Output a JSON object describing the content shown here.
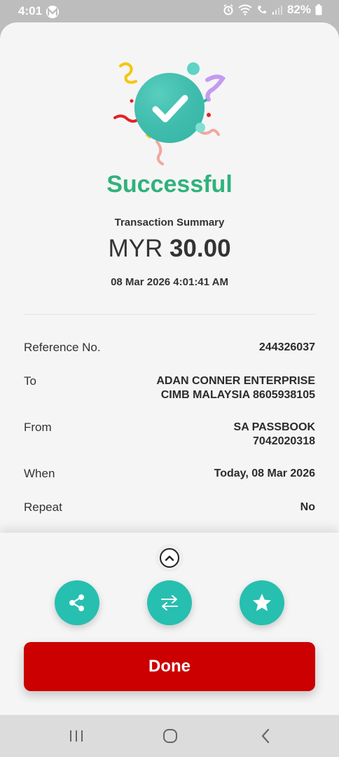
{
  "status_bar": {
    "time": "4:01",
    "battery": "82%"
  },
  "header": {
    "title": "Successful",
    "summary_label": "Transaction Summary",
    "currency": "MYR",
    "amount": "30.00",
    "datetime": "08 Mar 2026 4:01:41 AM"
  },
  "details": [
    {
      "label": "Reference No.",
      "value_lines": [
        "244326037"
      ]
    },
    {
      "label": "To",
      "value_lines": [
        "ADAN CONNER ENTERPRISE",
        "CIMB MALAYSIA 8605938105"
      ]
    },
    {
      "label": "From",
      "value_lines": [
        "SA PASSBOOK",
        "7042020318"
      ]
    },
    {
      "label": "When",
      "value_lines": [
        "Today, 08 Mar 2026"
      ]
    },
    {
      "label": "Repeat",
      "value_lines": [
        "No"
      ]
    }
  ],
  "actions": {
    "icons": [
      "share-icon",
      "transfer-icon",
      "star-icon"
    ],
    "done_label": "Done"
  },
  "colors": {
    "success": "#2fb27b",
    "accent": "#27bfb0",
    "primary": "#cc0000"
  }
}
